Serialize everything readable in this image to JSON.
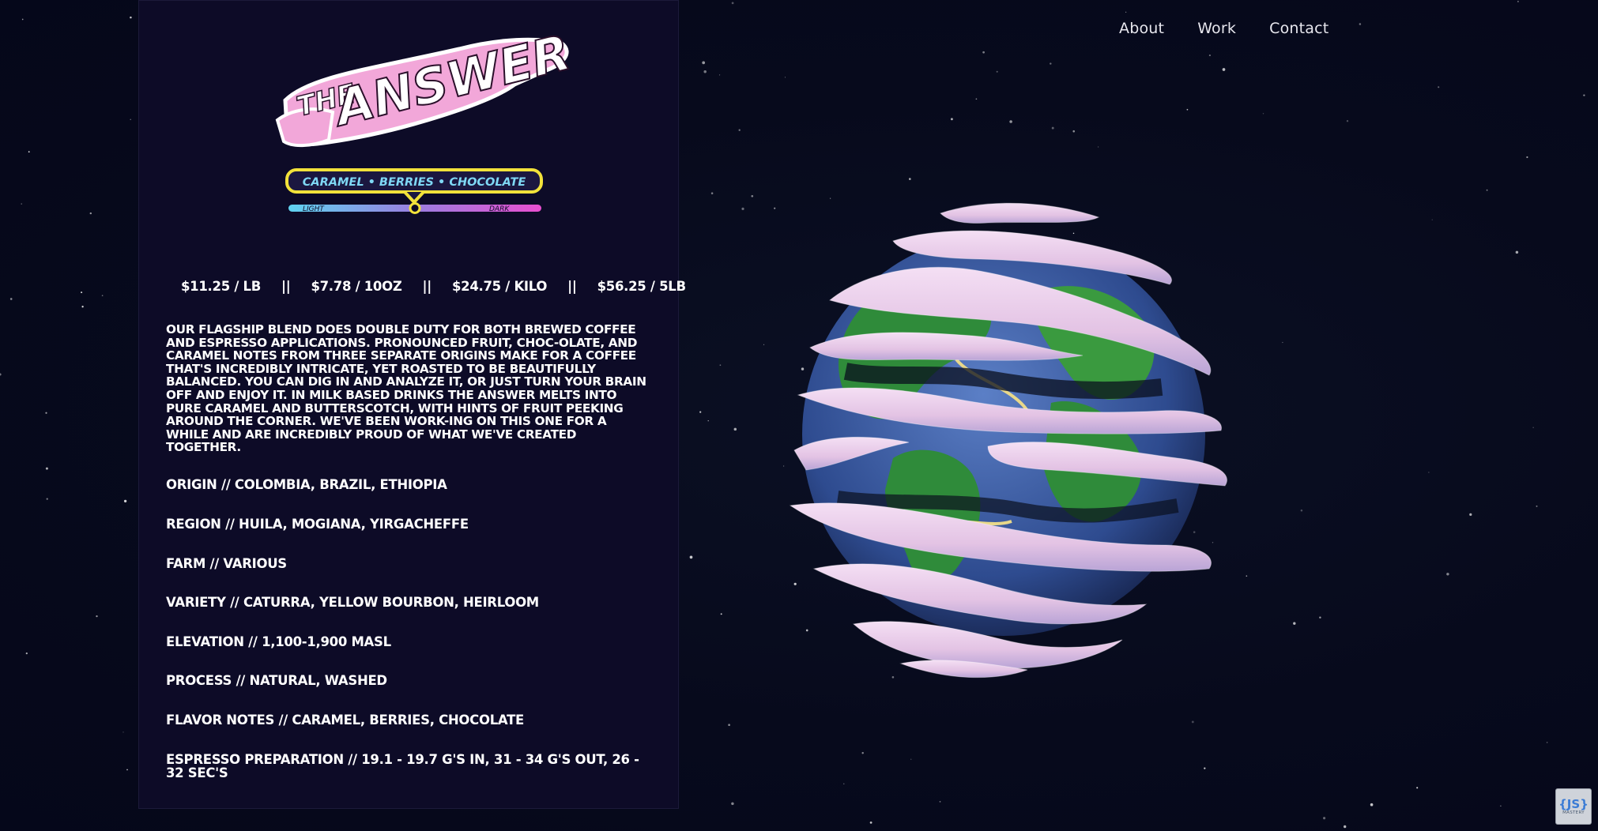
{
  "nav": {
    "items": [
      {
        "label": "About"
      },
      {
        "label": "Work"
      },
      {
        "label": "Contact"
      }
    ]
  },
  "product": {
    "logo_text_small": "THE",
    "logo_text_large": "ANSWER",
    "flavor_banner": "CARAMEL • BERRIES • CHOCOLATE",
    "roast_scale": {
      "light_label": "LIGHT",
      "dark_label": "DARK",
      "level": 0.5
    },
    "prices": [
      "$11.25 / LB",
      "$7.78 / 10OZ",
      "$24.75 / KILO",
      "$56.25 / 5LB"
    ],
    "price_separator": "||",
    "description": "OUR FLAGSHIP BLEND DOES DOUBLE DUTY FOR BOTH BREWED COFFEE AND ESPRESSO APPLICATIONS. PRONOUNCED FRUIT, CHOC-OLATE, AND CARAMEL NOTES FROM THREE SEPARATE ORIGINS MAKE FOR A COFFEE THAT'S INCREDIBLY INTRICATE, YET ROASTED TO BE BEAUTIFULLY BALANCED. YOU CAN DIG IN AND ANALYZE IT, OR JUST TURN YOUR BRAIN OFF AND ENJOY IT. IN MILK BASED DRINKS THE ANSWER MELTS INTO PURE CARAMEL AND BUTTERSCOTCH, WITH HINTS OF FRUIT PEEKING AROUND THE CORNER. WE'VE BEEN WORK-ING ON THIS ONE FOR A WHILE AND ARE INCREDIBLY PROUD OF WHAT WE'VE CREATED TOGETHER.",
    "specs": [
      "ORIGIN // COLOMBIA, BRAZIL, ETHIOPIA",
      "REGION // HUILA, MOGIANA, YIRGACHEFFE",
      "FARM // VARIOUS",
      "VARIETY //  CATURRA, YELLOW BOURBON, HEIRLOOM",
      "ELEVATION // 1,100-1,900 MASL",
      "PROCESS // NATURAL, WASHED",
      "FLAVOR NOTES // CARAMEL, BERRIES, CHOCOLATE",
      "ESPRESSO PREPARATION // 19.1 - 19.7 G'S IN, 31 - 34 G'S OUT, 26 - 32 SEC'S"
    ]
  },
  "badge": {
    "main": "{JS}",
    "sub": "MASTERY"
  },
  "colors": {
    "background": "#07091a",
    "card": "#0d0b27",
    "logo_pink": "#f2a7d9",
    "banner_yellow": "#f2e23a",
    "scale_cyan": "#5fd3f0",
    "scale_magenta": "#e94fd0",
    "ocean": "#3d5fa8",
    "land_green": "#2f8b3a",
    "cloud_pink": "#ead2ea"
  },
  "icons": {
    "globe": "globe-icon",
    "badge": "js-mastery-badge"
  }
}
